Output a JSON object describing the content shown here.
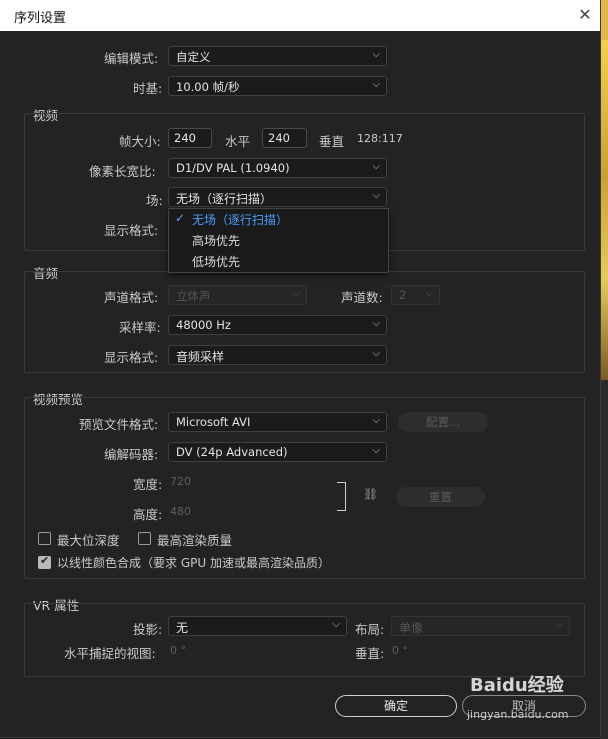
{
  "window": {
    "title": "序列设置",
    "close_glyph": "✕"
  },
  "general": {
    "edit_mode_label": "编辑模式:",
    "edit_mode_value": "自定义",
    "timebase_label": "时基:",
    "timebase_value": "10.00  帧/秒"
  },
  "video": {
    "section_title": "视频",
    "frame_size_label": "帧大小:",
    "frame_w": "240",
    "horizontal_label": "水平",
    "frame_h": "240",
    "vertical_label": "垂直",
    "aspect_ratio": "128:117",
    "pixel_aspect_label": "像素长宽比:",
    "pixel_aspect_value": "D1/DV PAL (1.0940)",
    "field_label": "场:",
    "field_value": "无场（逐行扫描）",
    "display_format_label": "显示格式:",
    "field_options": [
      "无场（逐行扫描）",
      "高场优先",
      "低场优先"
    ],
    "field_selected_index": 0
  },
  "audio": {
    "section_title": "音频",
    "channel_format_label": "声道格式:",
    "channel_format_value": "立体声",
    "channel_count_label": "声道数:",
    "channel_count_value": "2",
    "sample_rate_label": "采样率:",
    "sample_rate_value": "48000 Hz",
    "display_format_label": "显示格式:",
    "display_format_value": "音频采样"
  },
  "preview": {
    "section_title": "视频预览",
    "file_format_label": "预览文件格式:",
    "file_format_value": "Microsoft AVI",
    "config_button": "配置...",
    "codec_label": "编解码器:",
    "codec_value": "DV (24p Advanced)",
    "width_label": "宽度:",
    "width_value": "720",
    "height_label": "高度:",
    "height_value": "480",
    "reset_button": "重置",
    "max_bit_depth_label": "最大位深度",
    "max_bit_depth_checked": false,
    "max_render_quality_label": "最高渲染质量",
    "max_render_quality_checked": false,
    "linear_color_label": "以线性颜色合成（要求 GPU 加速或最高渲染品质）",
    "linear_color_checked": true
  },
  "vr": {
    "section_title": "VR 属性",
    "projection_label": "投影:",
    "projection_value": "无",
    "layout_label": "布局:",
    "layout_value": "单像",
    "h_view_label": "水平捕捉的视图:",
    "h_view_value": "0 °",
    "v_label": "垂直:",
    "v_value": "0 °"
  },
  "footer": {
    "ok": "确定",
    "cancel": "取消"
  },
  "watermark": {
    "brand": "Baidu经验",
    "url": "jingyan.baidu.com"
  }
}
